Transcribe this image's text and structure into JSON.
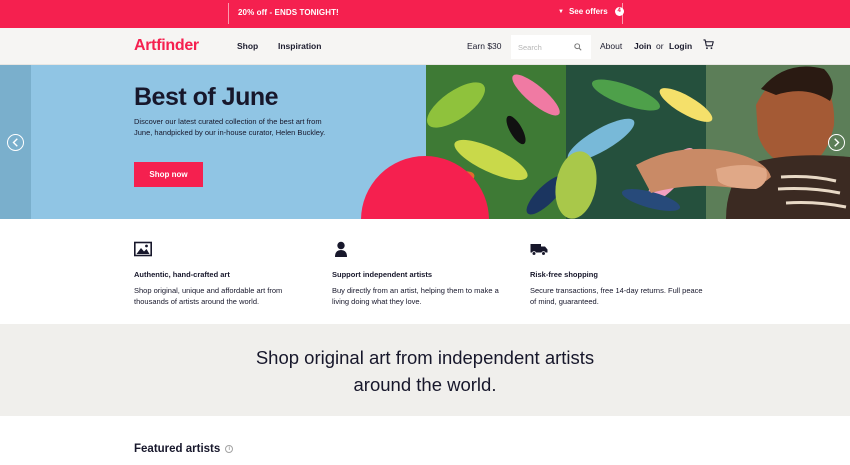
{
  "promo": {
    "text": "20% off - ENDS TONIGHT!",
    "offers_label": "See offers",
    "offers_count": "4",
    "color": "#f5204f"
  },
  "header": {
    "logo": "Artfinder",
    "nav": [
      "Shop",
      "Inspiration"
    ],
    "earn": "Earn $30",
    "search_placeholder": "Search",
    "about": "About",
    "join": "Join",
    "or": "or",
    "login": "Login",
    "icons": [
      "search-icon",
      "cart-icon"
    ]
  },
  "hero": {
    "title": "Best of June",
    "description": "Discover our latest curated collection of the best art from June, handpicked by our in-house curator, Helen Buckley.",
    "button": "Shop now",
    "background": "#90c5e4",
    "accent": "#f5204f",
    "icons": [
      "arrow-left-icon",
      "arrow-right-icon"
    ]
  },
  "features": [
    {
      "icon": "image-icon",
      "title": "Authentic, hand-crafted art",
      "description": "Shop original, unique and affordable art from thousands of artists around the world."
    },
    {
      "icon": "person-icon",
      "title": "Support independent artists",
      "description": "Buy directly from an artist, helping them to make a living doing what they love."
    },
    {
      "icon": "truck-icon",
      "title": "Risk-free shopping",
      "description": "Secure transactions, free 14-day returns. Full peace of mind, guaranteed."
    }
  ],
  "tagline": "Shop original art from independent artists around the world.",
  "featured": {
    "title": "Featured artists",
    "info_icon": "i"
  }
}
